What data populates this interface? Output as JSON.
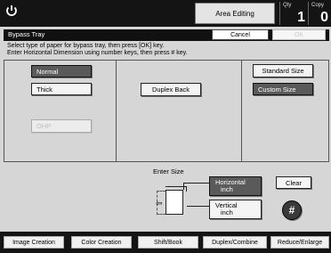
{
  "header": {
    "area_editing_label": "Area Editing",
    "qty_label": "Qty",
    "qty_value": "1",
    "copy_label": "Copy",
    "copy_value": "0"
  },
  "dialog": {
    "title": "Bypass Tray",
    "cancel_label": "Cancel",
    "ok_label": "OK",
    "instruction_1": "Select type of paper for bypass tray, then press [OK] key.",
    "instruction_2": "Enter Horizontal Dimension using number keys, then press # key."
  },
  "paper_types": {
    "normal": "Normal",
    "thick": "Thick",
    "ohp": "OHP",
    "selected": "Normal"
  },
  "duplex_back_label": "Duplex Back",
  "size": {
    "standard_label": "Standard Size",
    "custom_label": "Custom Size",
    "selected": "Custom Size",
    "enter_size_label": "Enter Size",
    "horizontal_label": "Horizontal",
    "horizontal_unit": "inch",
    "vertical_label": "Vertical",
    "vertical_unit": "inch",
    "clear_label": "Clear",
    "hash_label": "#"
  },
  "bottom_tabs": [
    "Image Creation",
    "Color Creation",
    "Shift/Book",
    "Duplex/Combine",
    "Reduce/Enlarge"
  ],
  "colors": {
    "bar": "#141414",
    "selected_button": "#5a5a5a",
    "background": "#d6d6d6"
  },
  "icons": {
    "power": "power-icon",
    "paper": "bypass-paper-icon",
    "hash": "hash-key-icon"
  }
}
